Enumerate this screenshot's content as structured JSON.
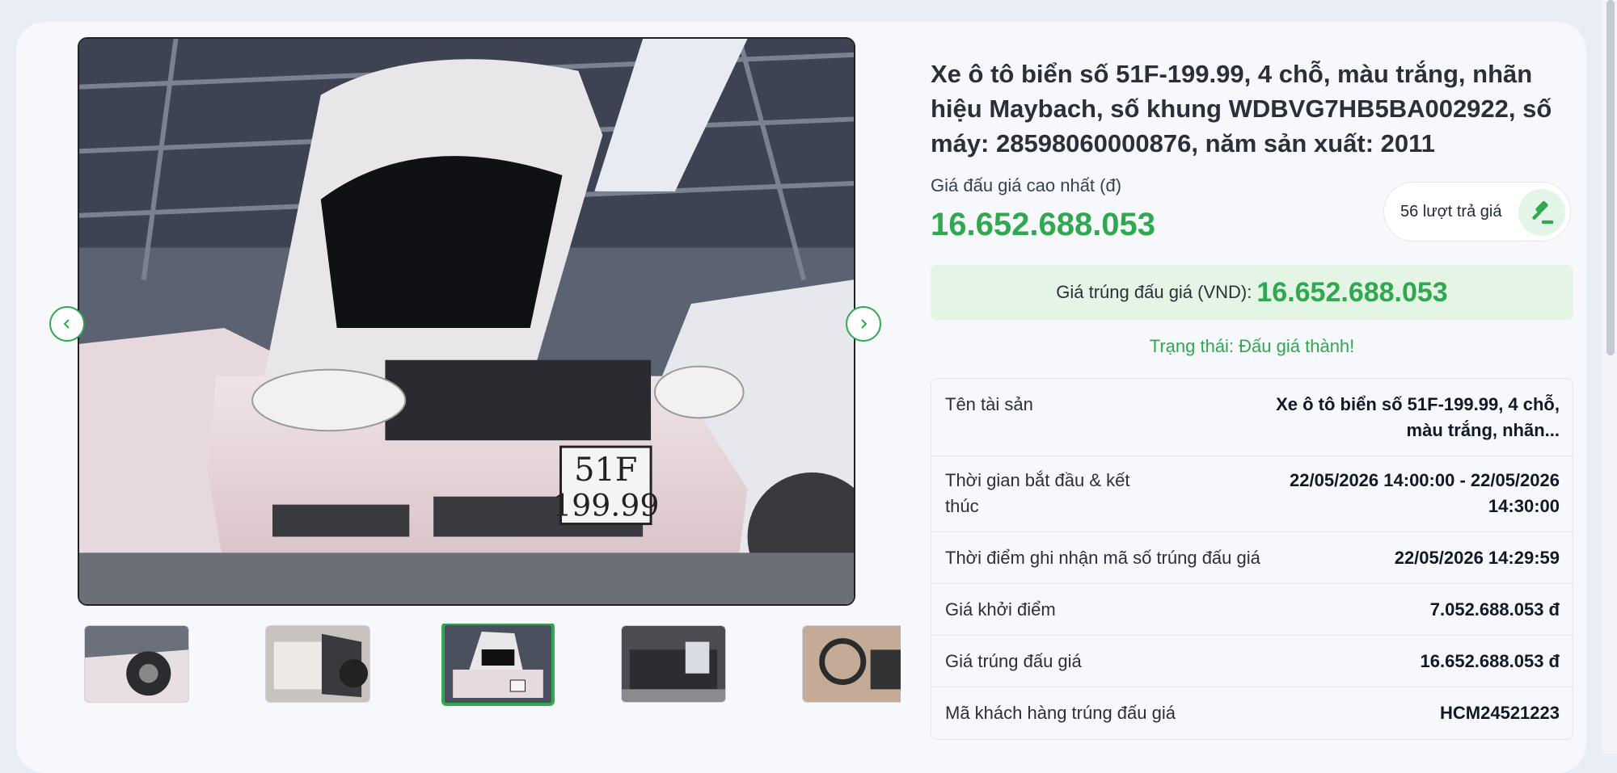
{
  "gallery": {
    "main_image_alt": "Xe ô tô Maybach màu trắng biển số 51F-199.99",
    "plate_line1": "51F",
    "plate_line2": "199.99",
    "prev_icon": "chevron-left-icon",
    "next_icon": "chevron-right-icon",
    "thumbnails": [
      {
        "subject": "wheel-view",
        "active": false
      },
      {
        "subject": "open-door-view",
        "active": false
      },
      {
        "subject": "front-hood-open-view",
        "active": true
      },
      {
        "subject": "trunk-view",
        "active": false
      },
      {
        "subject": "interior-dashboard-view",
        "active": false
      }
    ]
  },
  "asset": {
    "title": "Xe ô tô biển số 51F-199.99, 4 chỗ, màu trắng, nhãn hiệu Maybach, số khung WDBVG7HB5BA002922, số máy: 28598060000876, năm sản xuất: 2011",
    "highest_bid_label": "Giá đấu giá cao nhất (đ)",
    "highest_bid_value": "16.652.688.053",
    "bids_count_text": "56 lượt trả giá",
    "bids_icon": "gavel-icon",
    "winning_price_label": "Giá trúng đấu giá (VND):",
    "winning_price_value": "16.652.688.053",
    "status_text": "Trạng thái: Đấu giá thành!"
  },
  "details": [
    {
      "label": "Tên tài sản",
      "value": "Xe ô tô biển số 51F-199.99, 4 chỗ, màu trắng, nhãn..."
    },
    {
      "label": "Thời gian bắt đầu & kết thúc",
      "value": "22/05/2026 14:00:00 - 22/05/2026 14:30:00"
    },
    {
      "label": "Thời điểm ghi nhận mã số trúng đấu giá",
      "value": "22/05/2026 14:29:59"
    },
    {
      "label": "Giá khởi điểm",
      "value": "7.052.688.053 đ"
    },
    {
      "label": "Giá trúng đấu giá",
      "value": "16.652.688.053 đ"
    },
    {
      "label": "Mã khách hàng trúng đấu giá",
      "value": "HCM24521223"
    }
  ],
  "colors": {
    "accent_green": "#2fa84f",
    "win_box_bg": "#e5f5e5",
    "page_bg": "#e9edf6"
  }
}
